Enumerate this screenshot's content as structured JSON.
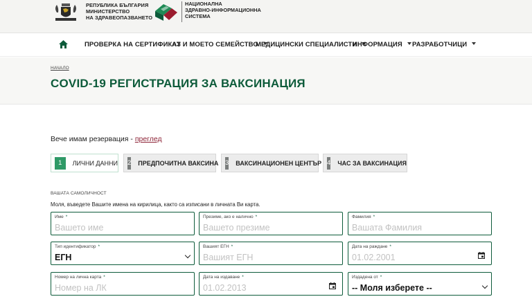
{
  "header": {
    "ministry_lines": [
      "РЕПУБЛИКА БЪЛГАРИЯ",
      "МИНИСТЕРСТВО",
      "НА ЗДРАВЕОПАЗВАНЕТО"
    ],
    "nzis_lines": [
      "НАЦИОНАЛНА",
      "ЗДРАВНО-ИНФОРМАЦИОННА",
      "СИСТЕМА"
    ]
  },
  "nav": {
    "items": [
      {
        "label": "ПРОВЕРКА НА СЕРТИФИКАТ"
      },
      {
        "label": "АЗ И МОЕТО СЕМЕЙСТВО"
      },
      {
        "label": "МЕДИЦИНСКИ СПЕЦИАЛИСТИ"
      },
      {
        "label": "ИНФОРМАЦИЯ"
      },
      {
        "label": "РАЗРАБОТЧИЦИ"
      }
    ]
  },
  "breadcrumb": "НАЧАЛО",
  "page_title": "COVID-19 РЕГИСТРАЦИЯ ЗА ВАКСИНАЦИЯ",
  "reservation": {
    "text": "Вече имам резервация - ",
    "link": "преглед"
  },
  "steps": [
    {
      "num": "1",
      "label": "ЛИЧНИ ДАННИ"
    },
    {
      "num": "2",
      "label": "ПРЕДПОЧИТНА ВАКСИНА"
    },
    {
      "num": "3",
      "label": "ВАКСИНАЦИОНЕН ЦЕНТЪР"
    },
    {
      "num": "4",
      "label": "ЧАС ЗА ВАКСИНАЦИЯ"
    }
  ],
  "form": {
    "section_label": "ВАШАТА САМОЛИЧНОСТ",
    "instruction": "Моля, въведете Вашите имена на кирилица, както са изписани в личната Ви карта.",
    "fields": {
      "first_name": {
        "label": "Име",
        "placeholder": "Вашето име"
      },
      "middle_name": {
        "label": "Презиме, ако е налично",
        "placeholder": "Вашето презиме"
      },
      "last_name": {
        "label": "Фамилия",
        "placeholder": "Вашата Фамилия"
      },
      "id_type": {
        "label": "Тип идентификатор",
        "value": "ЕГН"
      },
      "egn": {
        "label": "Вашият ЕГН",
        "placeholder": "Вашият ЕГН"
      },
      "birth_date": {
        "label": "Дата на раждане",
        "placeholder": "01.02.2001"
      },
      "id_card": {
        "label": "Номер на лична карта",
        "placeholder": "Номер на ЛК"
      },
      "issue_date": {
        "label": "Дата на издаване",
        "placeholder": "01.02.2013"
      },
      "issued_by": {
        "label": "Издадена от",
        "value": "-- Моля изберете --"
      }
    }
  },
  "colors": {
    "brand_green": "#0d5b3a",
    "step_active": "#2f9a67",
    "link": "#8c2235"
  }
}
